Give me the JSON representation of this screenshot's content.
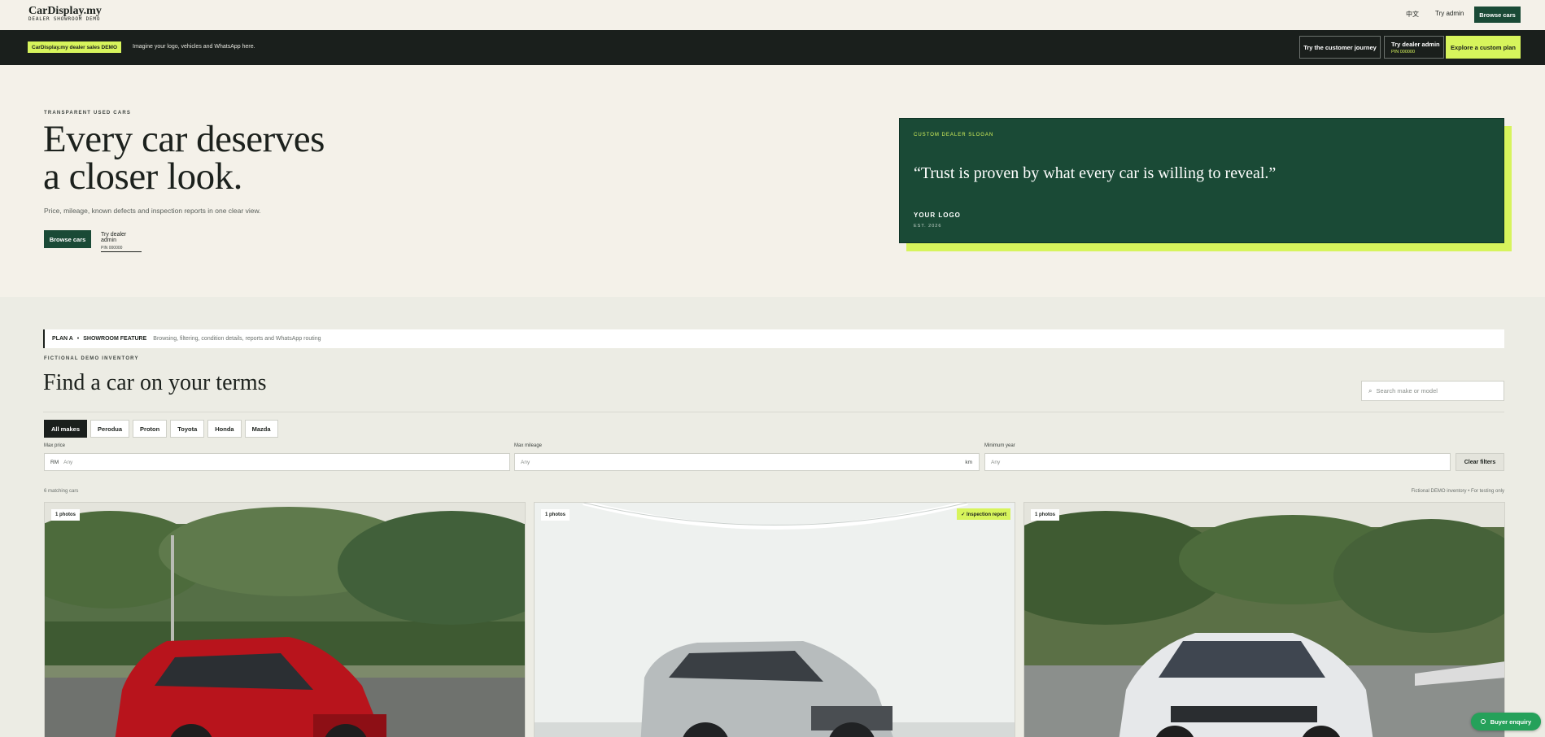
{
  "nav": {
    "logo": "CarDisplay.my",
    "logo_sub": "DEALER SHOWROOM DEMO",
    "lang": "中文",
    "try_admin": "Try admin",
    "browse_cars": "Browse cars"
  },
  "demo_bar": {
    "badge": "CarDisplay.my dealer sales DEMO",
    "text": "Imagine your logo, vehicles and WhatsApp here.",
    "customer_journey": "Try the customer journey",
    "dealer_admin": "Try dealer admin",
    "dealer_pin": "PIN 000000",
    "custom_plan": "Explore a custom plan"
  },
  "hero": {
    "eyebrow": "TRANSPARENT USED CARS",
    "title_line1": "Every car deserves",
    "title_line2": "a closer look.",
    "description": "Price, mileage, known defects and inspection reports in one clear view.",
    "browse_button": "Browse cars",
    "admin_link": "Try dealer admin",
    "admin_pin": "PIN 000000"
  },
  "slogan": {
    "eyebrow": "CUSTOM DEALER SLOGAN",
    "quote": "“Trust is proven by what every car is willing to reveal.”",
    "logo": "YOUR LOGO",
    "est": "EST. 2026"
  },
  "inventory": {
    "plan": "PLAN A",
    "feature": "SHOWROOM FEATURE",
    "feature_desc": "Browsing, filtering, condition details, reports and WhatsApp routing",
    "eyebrow": "FICTIONAL DEMO INVENTORY",
    "title": "Find a car on your terms",
    "search_placeholder": "Search make or model",
    "makes": [
      "All makes",
      "Perodua",
      "Proton",
      "Toyota",
      "Honda",
      "Mazda"
    ],
    "filters": {
      "max_price_label": "Max price",
      "max_price_prefix": "RM",
      "max_price_placeholder": "Any",
      "max_mileage_label": "Max mileage",
      "max_mileage_placeholder": "Any",
      "max_mileage_suffix": "km",
      "min_year_label": "Minimum year",
      "min_year_placeholder": "Any",
      "clear": "Clear filters"
    },
    "match_count": "6 matching cars",
    "note": "Fictional DEMO inventory  •  For testing only",
    "cards": [
      {
        "photos": "1 photos",
        "inspection": ""
      },
      {
        "photos": "1 photos",
        "inspection": "✓ Inspection report"
      },
      {
        "photos": "1 photos",
        "inspection": ""
      }
    ]
  },
  "enquiry": "Buyer enquiry",
  "colors": {
    "brand_green": "#1a4a36",
    "accent_lime": "#d7f45c",
    "dark": "#1a1f1c",
    "cream": "#f4f1e9",
    "whatsapp": "#25a15a"
  }
}
